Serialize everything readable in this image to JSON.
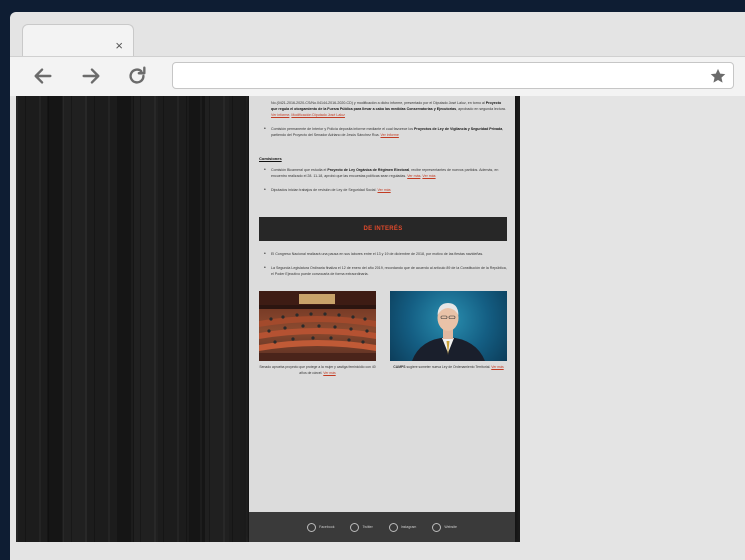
{
  "browser": {
    "tab_close": "×"
  },
  "content": {
    "p1_pre": "No.(0421-2016-2020-CS/No.04144-2016-2020-CD) y modificación a dicho informe, presentado por el Diputado José Laluz, en torno al ",
    "p1_bold": "Proyecto que regula el otorgamiento de la Fuerza Pública para llevar a cabo las medidas Conservatorias y Ejecutorias",
    "p1_post": ", aprobado en segunda lectura.",
    "p1_link1": "Ver informe",
    "p1_link2": "Modificación Diputado José Laluz",
    "p2_pre": "Comisión permanente de Interior y Policía deposita informe mediante el cual favorece los ",
    "p2_bold": "Proyectos de Ley de Vigilancia y Seguridad Privada",
    "p2_post": ", partiendo del Proyecto del Senador Adriano de Jesús Sánchez Roa.",
    "p2_link": "Ver informe",
    "section_title": "Comisiones",
    "c1_pre": "Comisión Bicameral que estudia el ",
    "c1_bold": "Proyecto de Ley Orgánica de Régimen Electoral",
    "c1_post": ", recibe representantes de nuevos partidos. Además, en encuentro realizado el 28. 11-18, aprobó que las encuestas políticas sean reguladas.",
    "c1_link1": "Ver más",
    "c1_link2": "Ver más",
    "c2_pre": "Diputados inician trabajos de revisión de Ley de Seguridad Social.",
    "c2_link": "Ver más",
    "banner_title": "DE INTERÉS",
    "i1": "El Congreso Nacional realizará una pausa en sus labores entre el 13 y 19 de diciembre de 2018, por motivo de las fiestas navideñas.",
    "i2": "La Segunda Legislatura Ordinaria finaliza el 12 de enero del año 2019, recordando que de acuerdo al artículo 89 de la Constitución de la República, el Poder Ejecutivo puede convocarla de forma extraordinaria.",
    "photo1_caption": "Senado aprueba proyecto que protege a la mujer y castiga feminicidio con 40 años de cárcel.",
    "photo1_link": "Ver más",
    "photo2_caption_bold": "CAMPS",
    "photo2_caption": " sugiere someter nueva Ley de Ordenamiento Territorial.",
    "photo2_link": "Ver más"
  },
  "footer": {
    "social": [
      "Facebook",
      "Twitter",
      "Instagram",
      "Website"
    ]
  }
}
